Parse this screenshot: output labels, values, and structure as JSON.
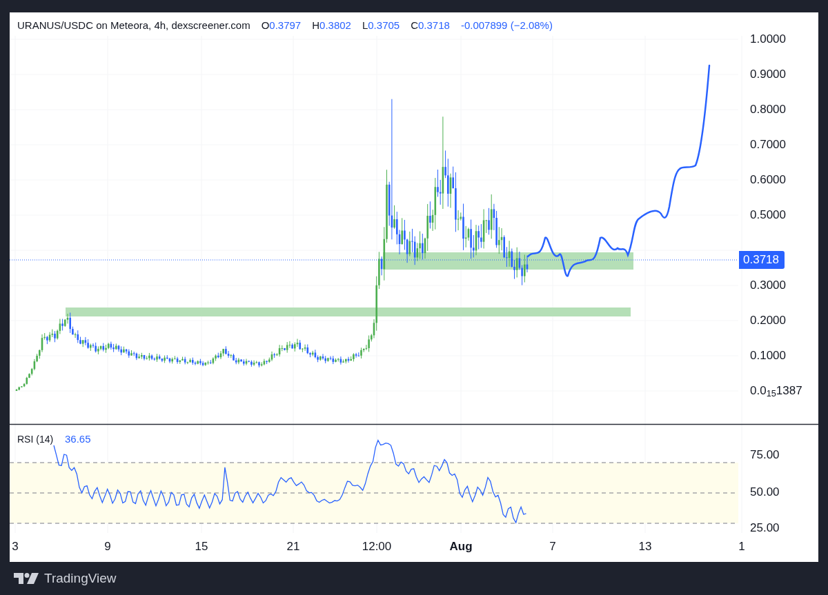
{
  "header": {
    "symbol": "URANUS/USDC on Meteora, 4h, dexscreener.com",
    "ohlc": [
      {
        "label": "O",
        "value": "0.3797"
      },
      {
        "label": "H",
        "value": "0.3802"
      },
      {
        "label": "L",
        "value": "0.3705"
      },
      {
        "label": "C",
        "value": "0.3718"
      }
    ],
    "change": "-0.007899 (−2.08%)"
  },
  "price_axis": {
    "labels": [
      "1.0000",
      "0.9000",
      "0.8000",
      "0.7000",
      "0.6000",
      "0.5000",
      "0.3000",
      "0.2000",
      "0.1000",
      "0.0$_{15}$1387"
    ],
    "last_price": "0.3718"
  },
  "rsi": {
    "title": "RSI (14)",
    "value": "36.65",
    "axis_labels": [
      "75.00",
      "50.00",
      "25.00"
    ]
  },
  "time_axis": [
    {
      "label": "3",
      "kind": "day"
    },
    {
      "label": "9",
      "kind": "day"
    },
    {
      "label": "15",
      "kind": "day"
    },
    {
      "label": "21",
      "kind": "day"
    },
    {
      "label": "12:00",
      "kind": "time"
    },
    {
      "label": "Aug",
      "kind": "month"
    },
    {
      "label": "7",
      "kind": "day"
    },
    {
      "label": "13",
      "kind": "day"
    },
    {
      "label": "1",
      "kind": "day"
    }
  ],
  "footer": {
    "brand": "TradingView"
  }
}
